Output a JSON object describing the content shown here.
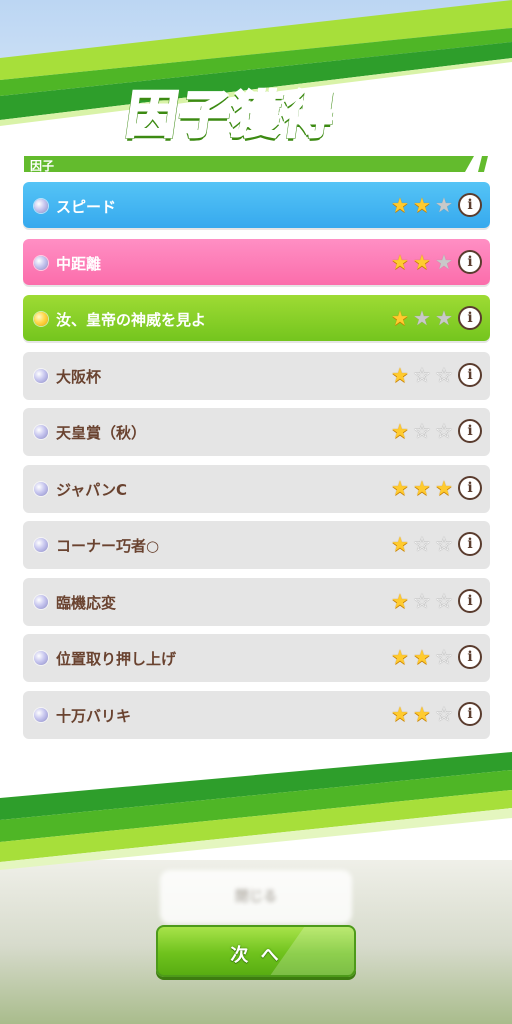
{
  "title": "因子獲得",
  "section": {
    "label": "因子"
  },
  "factors": [
    {
      "name": "スピード",
      "theme": "blue",
      "gem": "lavender",
      "stars": 2,
      "star_style": "gray"
    },
    {
      "name": "中距離",
      "theme": "pink",
      "gem": "lavender",
      "stars": 2,
      "star_style": "gray"
    },
    {
      "name": "汝、皇帝の神威を見よ",
      "theme": "green",
      "gem": "gold",
      "stars": 1,
      "star_style": "gray"
    },
    {
      "name": "大阪杯",
      "theme": "gray",
      "gem": "lavender",
      "stars": 1,
      "star_style": "empty"
    },
    {
      "name": "天皇賞（秋）",
      "theme": "gray",
      "gem": "lavender",
      "stars": 1,
      "star_style": "empty"
    },
    {
      "name": "ジャパンC",
      "theme": "gray",
      "gem": "lavender",
      "stars": 3,
      "star_style": "empty"
    },
    {
      "name": "コーナー巧者○",
      "theme": "gray",
      "gem": "lavender",
      "stars": 1,
      "star_style": "empty"
    },
    {
      "name": "臨機応変",
      "theme": "gray",
      "gem": "lavender",
      "stars": 1,
      "star_style": "empty"
    },
    {
      "name": "位置取り押し上げ",
      "theme": "gray",
      "gem": "lavender",
      "stars": 2,
      "star_style": "empty"
    },
    {
      "name": "十万バリキ",
      "theme": "gray",
      "gem": "lavender",
      "stars": 2,
      "star_style": "empty"
    }
  ],
  "info_glyph": "i",
  "star_glyph": "★",
  "star_empty_glyph": "☆",
  "background_button": {
    "label": "閉じる"
  },
  "next_button": {
    "label": "次 へ"
  },
  "colors": {
    "accent_green": "#63bb2d",
    "row_blue": "#36a9ee",
    "row_pink": "#fb6dab",
    "row_green": "#74c51e",
    "row_gray": "#e5e5e5",
    "text_brown": "#6a4330",
    "star_gold": "#ffcb2f"
  }
}
